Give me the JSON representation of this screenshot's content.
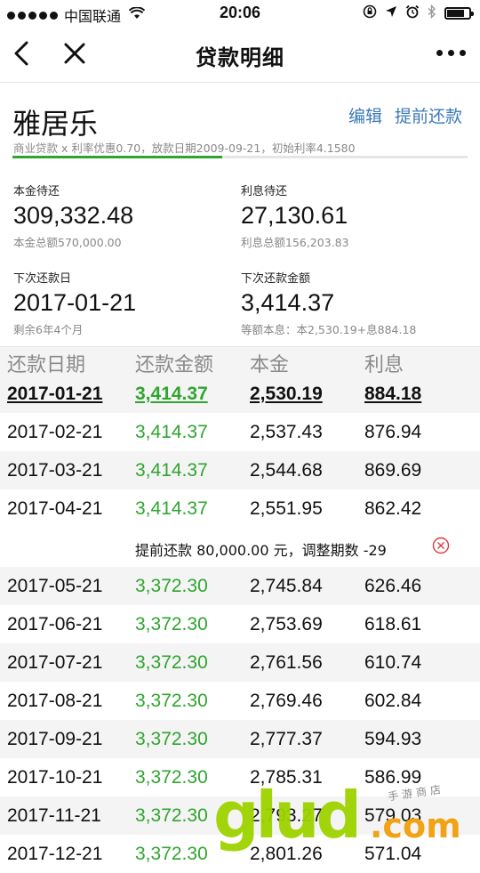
{
  "status_bar": {
    "carrier": "中国联通",
    "time": "20:06",
    "battery_level": 0.8
  },
  "nav": {
    "title": "贷款明细"
  },
  "loan": {
    "name": "雅居乐",
    "edit_label": "编辑",
    "prepay_label": "提前还款",
    "meta": "商业贷款 x 利率优惠0.70，放款日期2009-09-21，初始利率4.1580",
    "progress": 0.46
  },
  "stats": {
    "principal_remaining": {
      "label": "本金待还",
      "value": "309,332.48",
      "sub": "本金总额570,000.00"
    },
    "interest_remaining": {
      "label": "利息待还",
      "value": "27,130.61",
      "sub": "利息总额156,203.83"
    },
    "next_date": {
      "label": "下次还款日",
      "value": "2017-01-21",
      "sub": "剩余6年4个月"
    },
    "next_amount": {
      "label": "下次还款金额",
      "value": "3,414.37",
      "sub": "等额本息：本2,530.19+息884.18"
    }
  },
  "table": {
    "headers": [
      "还款日期",
      "还款金额",
      "本金",
      "利息"
    ],
    "rows_before": [
      {
        "date": "2017-01-21",
        "amount": "3,414.37",
        "principal": "2,530.19",
        "interest": "884.18"
      },
      {
        "date": "2017-02-21",
        "amount": "3,414.37",
        "principal": "2,537.43",
        "interest": "876.94"
      },
      {
        "date": "2017-03-21",
        "amount": "3,414.37",
        "principal": "2,544.68",
        "interest": "869.69"
      },
      {
        "date": "2017-04-21",
        "amount": "3,414.37",
        "principal": "2,551.95",
        "interest": "862.42"
      }
    ],
    "notice": "提前还款 80,000.00 元，调整期数 -29",
    "rows_after": [
      {
        "date": "2017-05-21",
        "amount": "3,372.30",
        "principal": "2,745.84",
        "interest": "626.46"
      },
      {
        "date": "2017-06-21",
        "amount": "3,372.30",
        "principal": "2,753.69",
        "interest": "618.61"
      },
      {
        "date": "2017-07-21",
        "amount": "3,372.30",
        "principal": "2,761.56",
        "interest": "610.74"
      },
      {
        "date": "2017-08-21",
        "amount": "3,372.30",
        "principal": "2,769.46",
        "interest": "602.84"
      },
      {
        "date": "2017-09-21",
        "amount": "3,372.30",
        "principal": "2,777.37",
        "interest": "594.93"
      },
      {
        "date": "2017-10-21",
        "amount": "3,372.30",
        "principal": "2,785.31",
        "interest": "586.99"
      },
      {
        "date": "2017-11-21",
        "amount": "3,372.30",
        "principal": "2,793.27",
        "interest": "579.03"
      },
      {
        "date": "2017-12-21",
        "amount": "3,372.30",
        "principal": "2,801.26",
        "interest": "571.04"
      }
    ]
  },
  "watermark": {
    "brand": "glud",
    "domain": ".com",
    "caption": "手游商店"
  },
  "colors": {
    "accent_green": "#2fa52f",
    "link_blue": "#3d7ab7",
    "cancel_red": "#e0393e"
  }
}
